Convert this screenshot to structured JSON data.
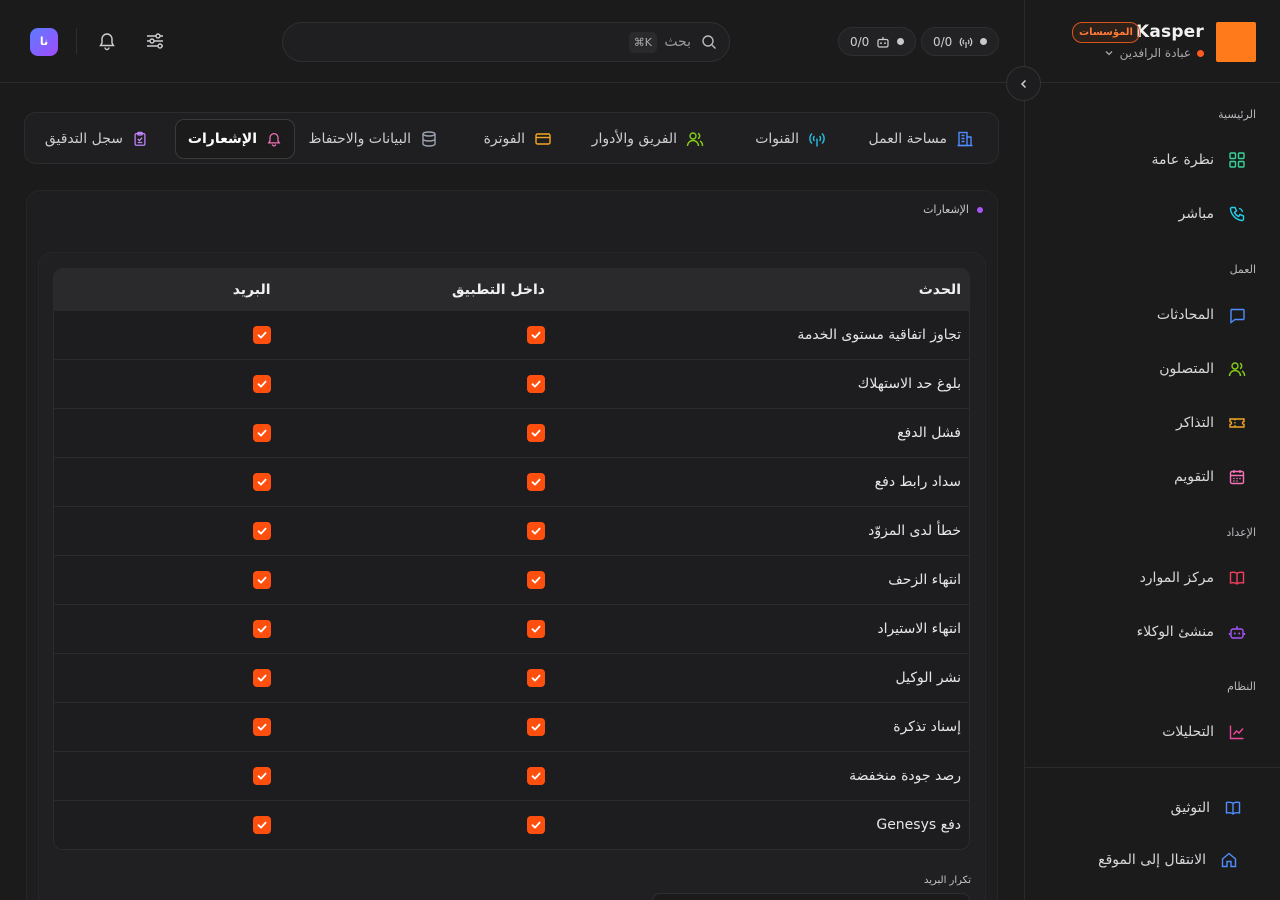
{
  "brand": {
    "name": "Kasper",
    "badge": "المؤسسات",
    "workspace": "عبادة الرافدين"
  },
  "topbar": {
    "status_channels": "0/0",
    "status_agents": "0/0",
    "search_placeholder": "بحث",
    "search_shortcut": "⌘K",
    "avatar_initials": "نا"
  },
  "sidebar": {
    "sections": [
      {
        "title": "الرئيسية",
        "items": [
          {
            "label": "نظرة عامة",
            "icon": "grid-icon"
          },
          {
            "label": "مباشر",
            "icon": "phone-icon"
          }
        ]
      },
      {
        "title": "العمل",
        "items": [
          {
            "label": "المحادثات",
            "icon": "chat-icon"
          },
          {
            "label": "المتصلون",
            "icon": "users-icon"
          },
          {
            "label": "التذاكر",
            "icon": "ticket-icon"
          },
          {
            "label": "التقويم",
            "icon": "calendar-icon"
          }
        ]
      },
      {
        "title": "الإعداد",
        "items": [
          {
            "label": "مركز الموارد",
            "icon": "book-icon"
          },
          {
            "label": "منشئ الوكلاء",
            "icon": "bot-icon"
          }
        ]
      },
      {
        "title": "النظام",
        "items": [
          {
            "label": "التحليلات",
            "icon": "chart-icon"
          }
        ]
      }
    ],
    "bottom": [
      {
        "label": "التوثيق",
        "icon": "book-open-icon"
      },
      {
        "label": "الانتقال إلى الموقع",
        "icon": "home-icon"
      }
    ]
  },
  "tabs": [
    {
      "label": "مساحة العمل",
      "icon": "building-icon",
      "color": "#4f8cff"
    },
    {
      "label": "القنوات",
      "icon": "antenna-icon",
      "color": "#22c3e6"
    },
    {
      "label": "الفريق والأدوار",
      "icon": "users-icon",
      "color": "#84cc16"
    },
    {
      "label": "الفوترة",
      "icon": "card-icon",
      "color": "#f5a623"
    },
    {
      "label": "البيانات والاحتفاظ",
      "icon": "database-icon",
      "color": "#9ca3af"
    },
    {
      "label": "الإشعارات",
      "icon": "bell-icon",
      "color": "#f472b6",
      "active": true
    },
    {
      "label": "سجل التدقيق",
      "icon": "clipboard-icon",
      "color": "#c084fc"
    }
  ],
  "section_title": "الإشعارات",
  "table": {
    "headers": {
      "event": "الحدث",
      "in_app": "داخل التطبيق",
      "email": "البريد"
    },
    "rows": [
      {
        "event": "تجاوز اتفاقية مستوى الخدمة",
        "in_app": true,
        "email": true
      },
      {
        "event": "بلوغ حد الاستهلاك",
        "in_app": true,
        "email": true
      },
      {
        "event": "فشل الدفع",
        "in_app": true,
        "email": true
      },
      {
        "event": "سداد رابط دفع",
        "in_app": true,
        "email": true
      },
      {
        "event": "خطأ لدى المزوّد",
        "in_app": true,
        "email": true
      },
      {
        "event": "انتهاء الزحف",
        "in_app": true,
        "email": true
      },
      {
        "event": "انتهاء الاستيراد",
        "in_app": true,
        "email": true
      },
      {
        "event": "نشر الوكيل",
        "in_app": true,
        "email": true
      },
      {
        "event": "إسناد تذكرة",
        "in_app": true,
        "email": true
      },
      {
        "event": "رصد جودة منخفضة",
        "in_app": true,
        "email": true
      },
      {
        "event": "دفع Genesys",
        "in_app": true,
        "email": true
      }
    ]
  },
  "email_frequency_label": "تكرار البريد",
  "colors": {
    "accent": "#ff4f0f",
    "brand": "#ff7a1a"
  }
}
